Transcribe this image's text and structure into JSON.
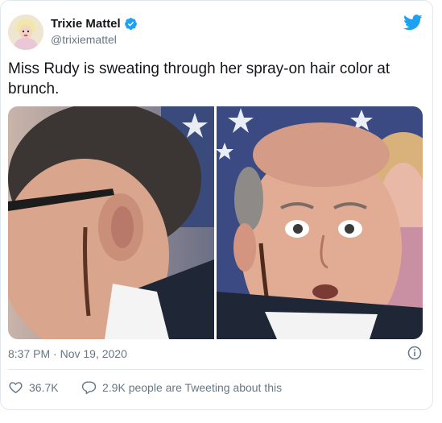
{
  "author": {
    "display_name": "Trixie Mattel",
    "handle": "@trixiemattel",
    "verified": true
  },
  "tweet": {
    "text": "Miss Rudy is sweating through her spray-on hair color at brunch.",
    "timestamp": "8:37 PM · Nov 19, 2020"
  },
  "stats": {
    "likes": "36.7K",
    "tweeting": "2.9K people are Tweeting about this"
  },
  "colors": {
    "twitter_blue": "#1da1f2",
    "secondary_text": "#657786",
    "border": "#e1e8ed"
  },
  "icons": {
    "verified": "verified-badge-icon",
    "logo": "twitter-bird-icon",
    "info": "info-icon",
    "like": "heart-icon",
    "reply": "speech-bubble-icon"
  }
}
